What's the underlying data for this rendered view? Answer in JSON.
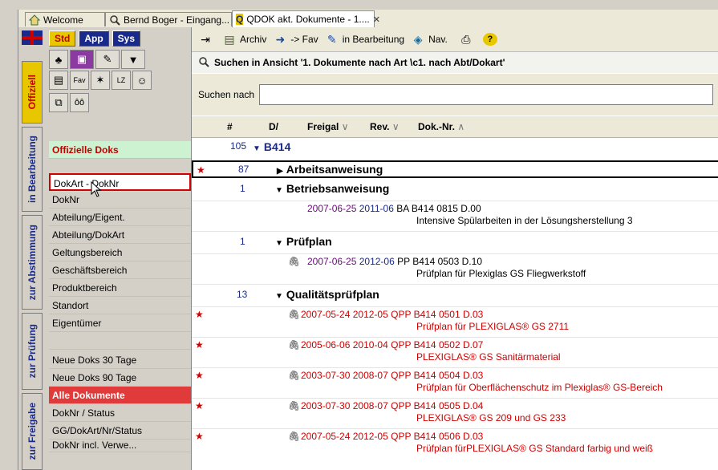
{
  "tabs": [
    {
      "label": "Welcome",
      "icon": "home-icon",
      "active": false
    },
    {
      "label": "Bernd Boger - Eingang...",
      "icon": "search-icon",
      "active": false
    },
    {
      "label": "QDOK akt. Dokumente - 1....",
      "icon": "qdok-icon",
      "active": true
    }
  ],
  "left": {
    "modes": [
      "Std",
      "App",
      "Sys"
    ],
    "vertical_tabs": [
      "Offiziell",
      "in Bearbeitung",
      "zur Abstimmung",
      "zur Prüfung",
      "zur Freigabe"
    ],
    "icon_labels": {
      "fav": "Fav",
      "lz": "LZ",
      "oo": "ôô"
    },
    "nav_items": [
      "Offizielle Doks",
      "DokArt - DokNr",
      "DokNr",
      "Abteilung/Eigent.",
      "Abteilung/DokArt",
      "Geltungsbereich",
      "Geschäftsbereich",
      "Produktbereich",
      "Standort",
      "Eigentümer",
      "",
      "Neue Doks 30 Tage",
      "Neue Doks 90 Tage",
      "Alle Dokumente",
      "DokNr / Status",
      "GG/DokArt/Nr/Status",
      "DokNr incl. Verwe..."
    ]
  },
  "toolbar": {
    "items": [
      {
        "label": "",
        "icon": "expand-icon"
      },
      {
        "label": "Archiv",
        "icon": "archive-icon"
      },
      {
        "label": "-> Fav",
        "icon": "fav-icon"
      },
      {
        "label": "in Bearbeitung",
        "icon": "edit-icon"
      },
      {
        "label": "Nav.",
        "icon": "nav-icon"
      },
      {
        "label": "",
        "icon": "print-icon"
      },
      {
        "label": "",
        "icon": "help-icon"
      }
    ]
  },
  "search": {
    "header": "Suchen in Ansicht '1. Dokumente nach Art \\c1. nach Abt/Dokart'",
    "label": "Suchen nach",
    "value": ""
  },
  "columns": [
    "#",
    "D/",
    "Freigal",
    "Rev.",
    "Dok.-Nr."
  ],
  "tree": {
    "root": {
      "count": "105",
      "label": "B414"
    },
    "groups": [
      {
        "count": "87",
        "label": "Arbeitsanweisung",
        "collapsed": true,
        "star": true
      },
      {
        "count": "1",
        "label": "Betriebsanweisung"
      },
      {
        "count": "1",
        "label": "Prüfplan"
      },
      {
        "count": "13",
        "label": "Qualitätsprüfplan"
      }
    ],
    "docs": [
      {
        "date": "2007-06-25",
        "rev": "2011-06",
        "nr": "BA B414 0815 D.00",
        "title": "Intensive Spülarbeiten in der Lösungsherstellung 3",
        "red": false,
        "star": false,
        "clip": false
      },
      {
        "date": "2007-06-25",
        "rev": "2012-06",
        "nr": "PP B414 0503 D.10",
        "title": "Prüfplan für Plexiglas GS Fliegwerkstoff",
        "red": false,
        "star": false,
        "clip": true
      },
      {
        "date": "2007-05-24",
        "rev": "2012-05",
        "nr": "QPP B414 0501 D.03",
        "title": "Prüfplan für PLEXIGLAS® GS 2711",
        "red": true,
        "star": true,
        "clip": true
      },
      {
        "date": "2005-06-06",
        "rev": "2010-04",
        "nr": "QPP B414 0502 D.07",
        "title": "PLEXIGLAS® GS Sanitärmaterial",
        "red": true,
        "star": true,
        "clip": true
      },
      {
        "date": "2003-07-30",
        "rev": "2008-07",
        "nr": "QPP B414 0504 D.03",
        "title": "Prüfplan für Oberflächenschutz im Plexiglas® GS-Bereich",
        "red": true,
        "star": true,
        "clip": true
      },
      {
        "date": "2003-07-30",
        "rev": "2008-07",
        "nr": "QPP B414 0505 D.04",
        "title": "PLEXIGLAS® GS 209 und GS 233",
        "red": true,
        "star": true,
        "clip": true
      },
      {
        "date": "2007-05-24",
        "rev": "2012-05",
        "nr": "QPP B414 0506 D.03",
        "title": "Prüfplan fürPLEXIGLAS® GS Standard farbig und weiß",
        "red": true,
        "star": true,
        "clip": true
      }
    ]
  },
  "colors": {
    "accent": "#1a2a8a",
    "highlight": "#e8c600",
    "alert": "#d00000",
    "green_item": "#ccf2d2"
  }
}
